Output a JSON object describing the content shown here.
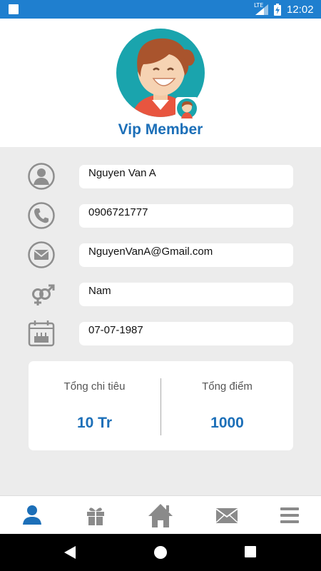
{
  "status_bar": {
    "network": "LTE",
    "time": "12:02",
    "color": "#1f7fcf"
  },
  "header": {
    "avatar_icon": "user-avatar-icon",
    "badge_icon": "mini-avatar-badge-icon",
    "title": "Vip Member"
  },
  "profile": {
    "fields": [
      {
        "icon": "person-icon",
        "value": "Nguyen Van A"
      },
      {
        "icon": "phone-icon",
        "value": "0906721777"
      },
      {
        "icon": "mail-icon",
        "value": "NguyenVanA@Gmail.com"
      },
      {
        "icon": "gender-icon",
        "value": "Nam"
      },
      {
        "icon": "birthday-calendar-icon",
        "value": "07-07-1987"
      }
    ]
  },
  "stats": {
    "spending_label": "Tổng chi tiêu",
    "spending_value": "10 Tr",
    "points_label": "Tổng điểm",
    "points_value": "1000"
  },
  "bottom_nav": {
    "items": [
      {
        "icon": "profile-icon",
        "active": true
      },
      {
        "icon": "gift-icon",
        "active": false
      },
      {
        "icon": "home-icon",
        "active": false
      },
      {
        "icon": "mail-icon",
        "active": false
      },
      {
        "icon": "menu-icon",
        "active": false
      }
    ],
    "active_color": "#1c6fb8",
    "inactive_color": "#8a8a8a"
  },
  "accent_color": "#1c6fb8"
}
